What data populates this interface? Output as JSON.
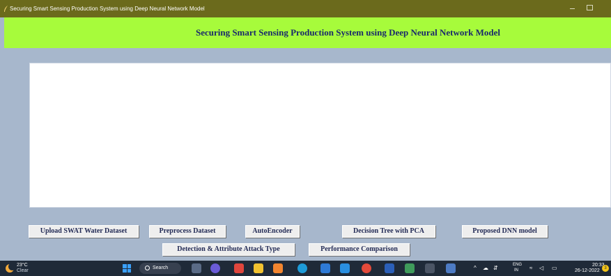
{
  "window": {
    "title": "Securing Smart Sensing Production System using Deep Neural Network Model"
  },
  "banner": {
    "heading": "Securing Smart Sensing Production System using Deep Neural Network Model",
    "background": "#a7fb3b"
  },
  "output": {
    "text": ""
  },
  "buttons": {
    "upload": "Upload SWAT Water Dataset",
    "preprocess": "Preprocess Dataset",
    "autoencoder": "AutoEncoder",
    "decision_tree": "Decision Tree with PCA",
    "proposed_dnn": "Proposed DNN model",
    "detection": "Detection & Attribute Attack Type",
    "performance": "Performance Comparison"
  },
  "taskbar": {
    "weather_temp": "23°C",
    "weather_condition": "Clear",
    "search_label": "Search",
    "lang_primary": "ENG",
    "lang_secondary": "IN",
    "time": "20:33",
    "date": "26-12-2022",
    "notification_count": "3"
  },
  "colors": {
    "titlebar": "#6b6a1c",
    "body": "#a7b7cc",
    "taskbar": "#1f2a38"
  }
}
